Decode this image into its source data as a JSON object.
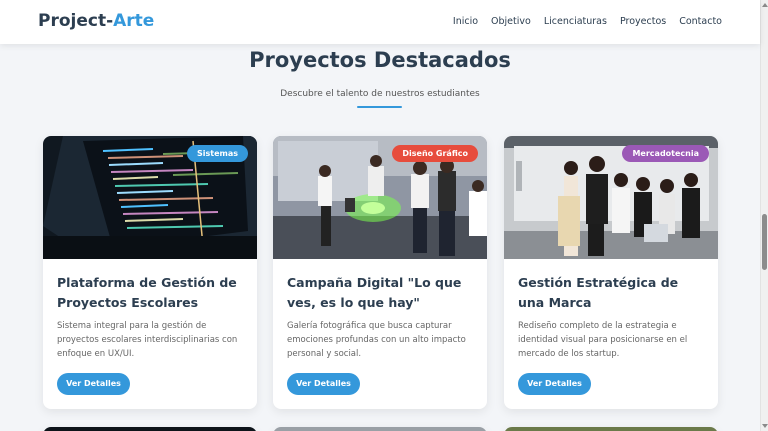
{
  "brand": {
    "part1": "Project-",
    "part2": "Arte"
  },
  "nav": [
    "Inicio",
    "Objetivo",
    "Licenciaturas",
    "Proyectos",
    "Contacto"
  ],
  "section": {
    "title": "Proyectos Destacados",
    "subtitle": "Descubre el talento de nuestros estudiantes"
  },
  "projects": [
    {
      "badge": "Sistemas",
      "badge_color": "#3498db",
      "title": "Plataforma de Gestión de Proyectos Escolares",
      "description": "Sistema integral para la gestión de proyectos escolares interdisciplinarias con enfoque en UX/UI.",
      "button": "Ver Detalles"
    },
    {
      "badge": "Diseño Gráfico",
      "badge_color": "#e74c3c",
      "title": "Campaña Digital \"Lo que ves, es lo que hay\"",
      "description": "Galería fotográfica que busca capturar emociones profundas con un alto impacto personal y social.",
      "button": "Ver Detalles"
    },
    {
      "badge": "Mercadotecnia",
      "badge_color": "#9b59b6",
      "title": "Gestión Estratégica de una Marca",
      "description": "Rediseño completo de la estrategia e identidad visual para posicionarse en el mercado de los startup.",
      "button": "Ver Detalles"
    }
  ],
  "colors": {
    "accent": "#3498db",
    "text": "#2c3e50",
    "background": "#f3f5f8"
  }
}
